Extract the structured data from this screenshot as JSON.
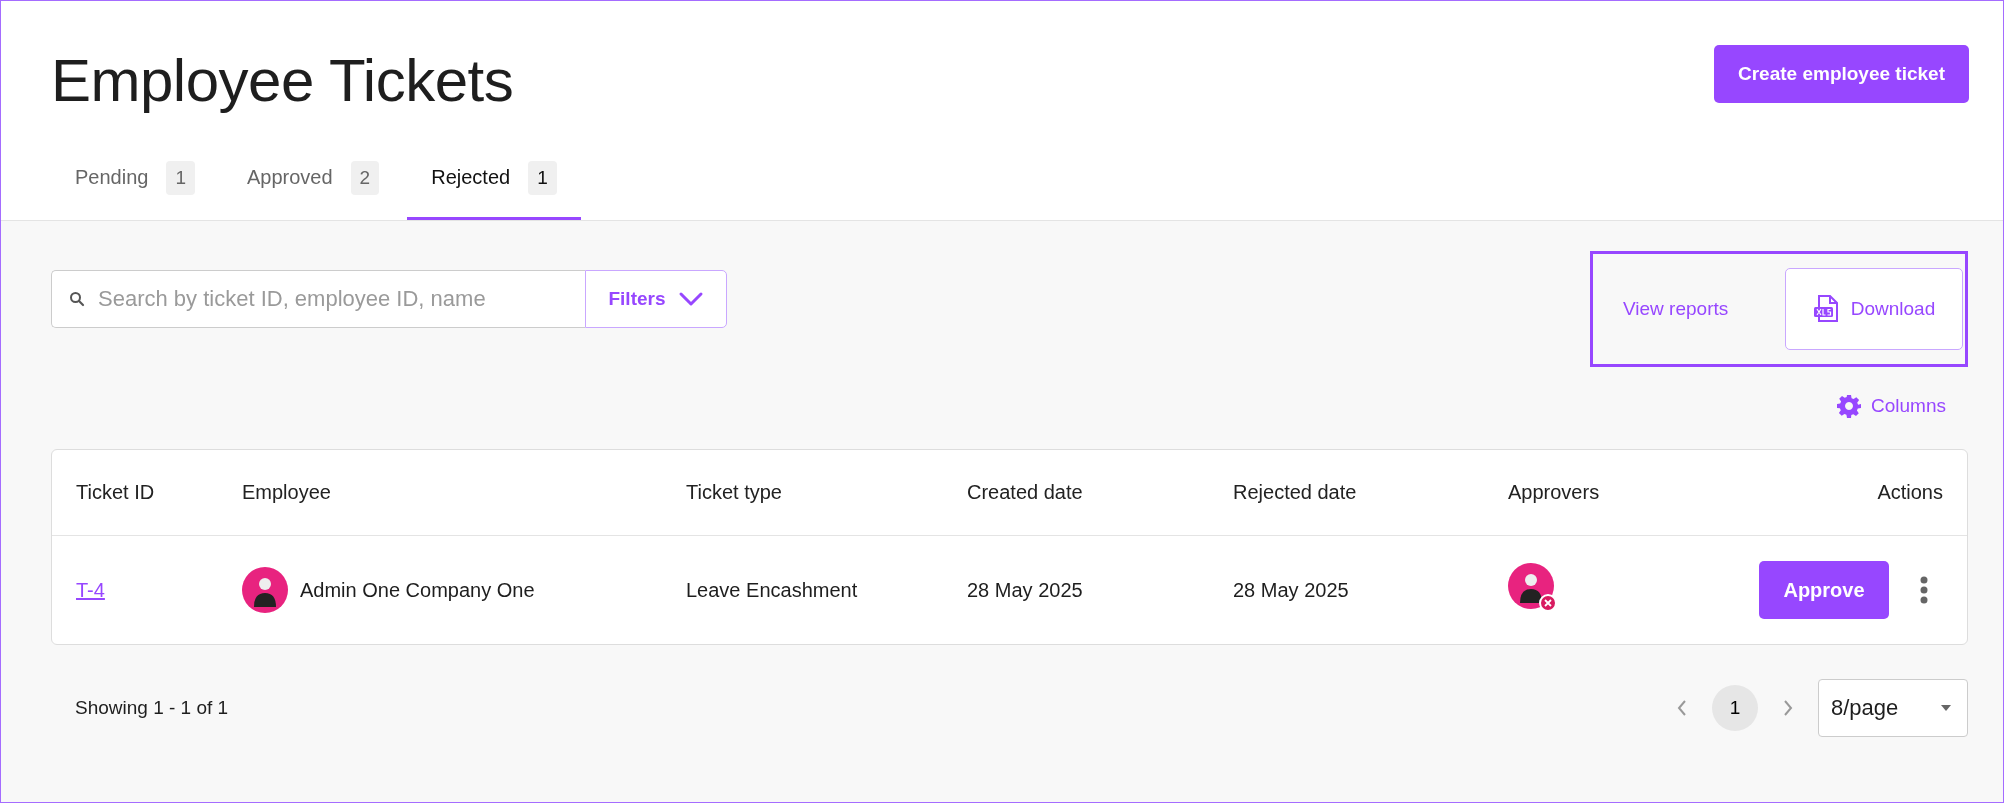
{
  "page": {
    "title": "Employee Tickets",
    "create_button": "Create employee ticket"
  },
  "tabs": [
    {
      "label": "Pending",
      "count": "1",
      "selected": false
    },
    {
      "label": "Approved",
      "count": "2",
      "selected": false
    },
    {
      "label": "Rejected",
      "count": "1",
      "selected": true
    }
  ],
  "search": {
    "placeholder": "Search by ticket ID, employee ID, name"
  },
  "filters_button": "Filters",
  "view_reports": "View reports",
  "download_button": "Download",
  "columns_button": "Columns",
  "table": {
    "columns": [
      "Ticket ID",
      "Employee",
      "Ticket type",
      "Created date",
      "Rejected date",
      "Approvers",
      "Actions"
    ],
    "rows": [
      {
        "ticket_id": "T-4",
        "employee": "Admin One Company One",
        "ticket_type": "Leave Encashment",
        "created_date": "28 May 2025",
        "rejected_date": "28 May 2025",
        "approvers": [
          {
            "rejected": true
          }
        ],
        "action": "Approve"
      }
    ]
  },
  "pagination": {
    "summary": "Showing 1 - 1 of 1",
    "pages": [
      {
        "label": "1",
        "selected": true
      }
    ],
    "page_size": "8/page"
  }
}
